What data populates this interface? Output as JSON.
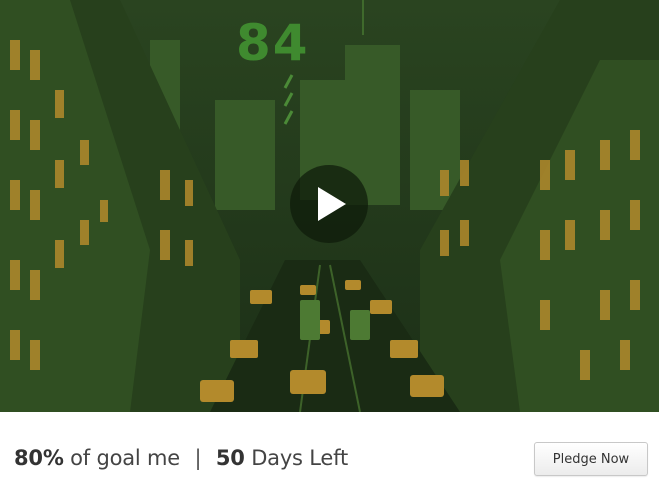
{
  "video": {
    "logo_text": "84",
    "play_icon": "play-icon",
    "tint": "#2c4a1f",
    "accent": "#b8912e"
  },
  "funding": {
    "percent": "80%",
    "percent_suffix": "of goal me",
    "separator": "|",
    "days": "50",
    "days_suffix": "Days Left"
  },
  "actions": {
    "pledge_label": "Pledge Now"
  }
}
